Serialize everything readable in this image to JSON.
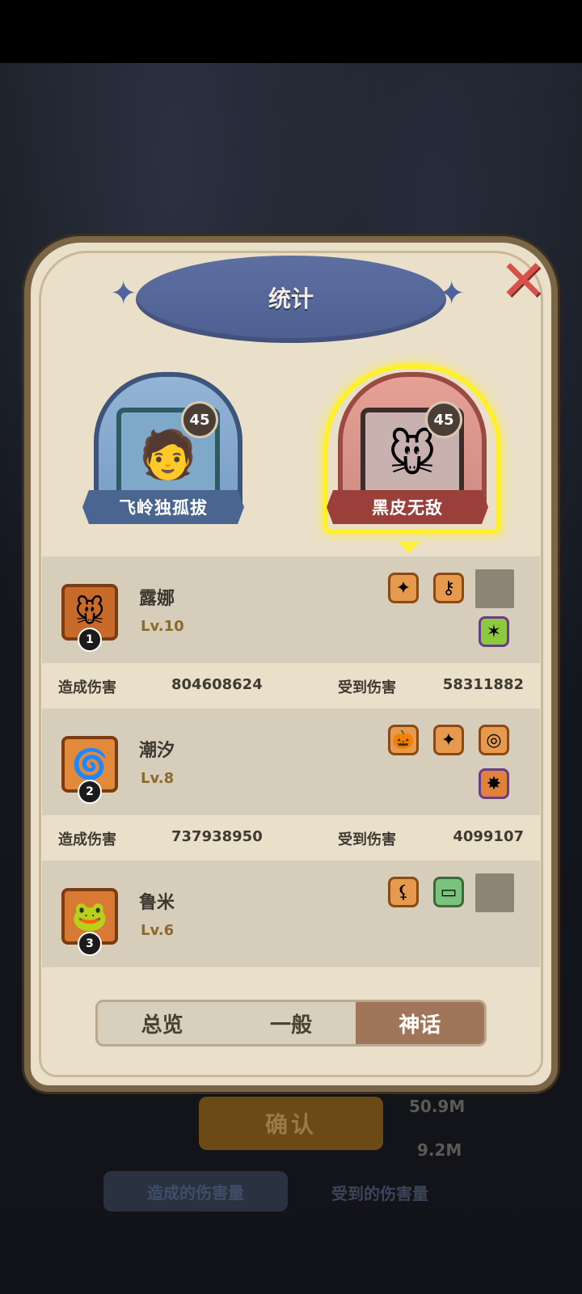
{
  "background": {
    "confirm_label": "确认",
    "dim_values": [
      "50.9M",
      "9.2M"
    ],
    "dim_tab_dealt": "造成的伤害量",
    "dim_tab_taken": "受到的伤害量"
  },
  "dialog": {
    "title": "统计",
    "close_icon": "close-x-icon"
  },
  "teams": [
    {
      "name": "飞岭独孤拔",
      "level": "45",
      "color": "blue",
      "selected": false,
      "portrait": "🧑"
    },
    {
      "name": "黑皮无敌",
      "level": "45",
      "color": "red",
      "selected": true,
      "portrait": "🐭"
    }
  ],
  "heroes": [
    {
      "rank": "1",
      "name": "露娜",
      "level": "Lv.10",
      "avatar": "🐭",
      "damage_dealt_label": "造成伤害",
      "damage_dealt": "804608624",
      "damage_taken_label": "受到伤害",
      "damage_taken": "58311882"
    },
    {
      "rank": "2",
      "name": "潮汐",
      "level": "Lv.8",
      "avatar": "🌀",
      "damage_dealt_label": "造成伤害",
      "damage_dealt": "737938950",
      "damage_taken_label": "受到伤害",
      "damage_taken": "4099107"
    },
    {
      "rank": "3",
      "name": "鲁米",
      "level": "Lv.6",
      "avatar": "🐸"
    }
  ],
  "tabs": [
    {
      "label": "总览",
      "active": false
    },
    {
      "label": "一般",
      "active": false
    },
    {
      "label": "神话",
      "active": true
    }
  ],
  "colors": {
    "panel": "#eadfc9",
    "title_oval": "#5d6fa0",
    "active_tab": "#a0765a",
    "selected_glow": "#fff02b"
  }
}
